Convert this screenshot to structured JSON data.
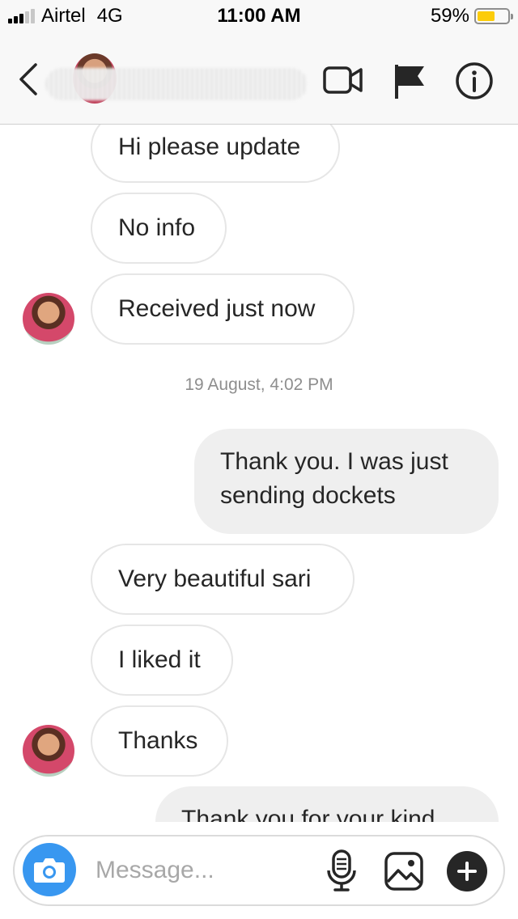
{
  "status_bar": {
    "carrier": "Airtel",
    "network": "4G",
    "time": "11:00 AM",
    "battery": "59%",
    "battery_level": 0.59
  },
  "nav": {
    "contact_name": "",
    "icons": [
      "back-chevron-icon",
      "video-camera-icon",
      "flag-icon",
      "info-icon"
    ]
  },
  "messages": [
    {
      "from": "them",
      "text": "Hi please update"
    },
    {
      "from": "them",
      "text": "No info"
    },
    {
      "from": "them",
      "text": "Received just now"
    },
    {
      "type": "timestamp",
      "text": "19 August, 4:02 PM"
    },
    {
      "from": "me",
      "text": "Thank you. I was just sending dockets"
    },
    {
      "from": "them",
      "text": "Very beautiful sari"
    },
    {
      "from": "them",
      "text": "I liked it"
    },
    {
      "from": "them",
      "text": "Thanks"
    },
    {
      "from": "me",
      "text": "Thank you for your kind"
    }
  ],
  "composer": {
    "placeholder": "Message...",
    "icons": [
      "camera-icon",
      "microphone-icon",
      "gallery-icon",
      "plus-icon"
    ]
  },
  "colors": {
    "accent_blue": "#3897f0",
    "outgoing_bubble": "#efefef",
    "incoming_border": "#e6e6e6",
    "battery_yellow": "#fccc0a"
  }
}
